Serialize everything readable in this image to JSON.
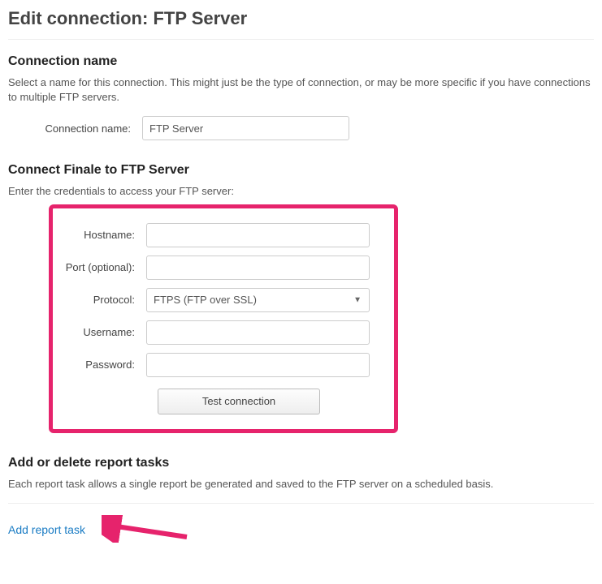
{
  "header": {
    "title": "Edit connection: FTP Server"
  },
  "connectionName": {
    "heading": "Connection name",
    "desc": "Select a name for this connection. This might just be the type of connection, or may be more specific if you have connections to multiple FTP servers.",
    "label": "Connection name:",
    "value": "FTP Server"
  },
  "credentials": {
    "heading": "Connect Finale to FTP Server",
    "desc": "Enter the credentials to access your FTP server:",
    "hostname": {
      "label": "Hostname:",
      "value": ""
    },
    "port": {
      "label": "Port (optional):",
      "value": ""
    },
    "protocol": {
      "label": "Protocol:",
      "value": "FTPS (FTP over SSL)"
    },
    "username": {
      "label": "Username:",
      "value": ""
    },
    "password": {
      "label": "Password:",
      "value": ""
    },
    "testButton": "Test connection"
  },
  "reportTasks": {
    "heading": "Add or delete report tasks",
    "desc": "Each report task allows a single report be generated and saved to the FTP server on a scheduled basis.",
    "addLink": "Add report task"
  },
  "annotations": {
    "highlightColor": "#e6236c"
  }
}
